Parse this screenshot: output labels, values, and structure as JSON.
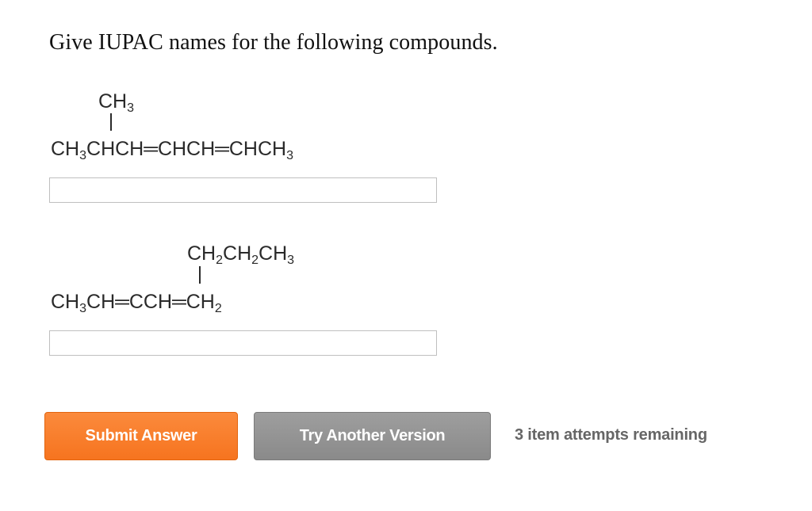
{
  "question": {
    "prompt": "Give IUPAC names for the following compounds."
  },
  "compounds": [
    {
      "branch": {
        "p1": "CH",
        "s1": "3"
      },
      "chain": {
        "p1": "CH",
        "s1": "3",
        "p2": "CHCH═CHCH═CHCH",
        "s2": "3"
      },
      "answer_value": "",
      "answer_placeholder": ""
    },
    {
      "branch": {
        "p1": "CH",
        "s1": "2",
        "p2": "CH",
        "s2": "2",
        "p3": "CH",
        "s3": "3"
      },
      "chain": {
        "p1": "CH",
        "s1": "3",
        "p2": "CH═CCH═CH",
        "s2": "2"
      },
      "answer_value": "",
      "answer_placeholder": ""
    }
  ],
  "actions": {
    "submit_label": "Submit Answer",
    "try_another_label": "Try Another Version",
    "attempts_text": "3 item attempts remaining"
  },
  "colors": {
    "submit_button": "#f6741f",
    "try_button": "#8a8a8a",
    "attempts_text": "#666666"
  }
}
